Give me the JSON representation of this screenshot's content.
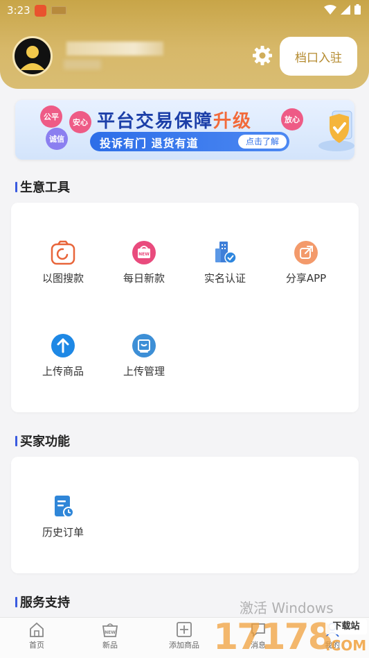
{
  "status_bar": {
    "time": "3:23"
  },
  "profile": {
    "enter_button": "档口入驻"
  },
  "banner": {
    "title_main": "平台交易保障",
    "title_highlight": "升级",
    "subtitle": "投诉有门 退货有道",
    "button": "点击了解",
    "tags": [
      "公平",
      "安心",
      "诚信",
      "放心"
    ]
  },
  "business_tools": {
    "title": "生意工具",
    "items": [
      {
        "label": "以图搜款",
        "icon": "camera-search-icon"
      },
      {
        "label": "每日新款",
        "icon": "new-bag-icon"
      },
      {
        "label": "实名认证",
        "icon": "verify-building-icon"
      },
      {
        "label": "分享APP",
        "icon": "share-icon"
      },
      {
        "label": "上传商品",
        "icon": "upload-arrow-icon"
      },
      {
        "label": "上传管理",
        "icon": "upload-manage-icon"
      }
    ]
  },
  "buyer_functions": {
    "title": "买家功能",
    "items": [
      {
        "label": "历史订单",
        "icon": "order-history-icon"
      }
    ]
  },
  "service_support": {
    "title": "服务支持"
  },
  "bottom_nav": {
    "items": [
      {
        "label": "首页",
        "icon": "home-icon"
      },
      {
        "label": "新品",
        "icon": "new-products-icon"
      },
      {
        "label": "添加商品",
        "icon": "add-product-icon"
      },
      {
        "label": "消息",
        "icon": "message-icon"
      },
      {
        "label": "我的",
        "icon": "profile-icon"
      }
    ]
  },
  "overlay": {
    "activate_windows": "激活 Windows",
    "site_logo": "17178",
    "site_tag": "下载站",
    "site_suffix": ".COM"
  },
  "colors": {
    "header_gold": "#c8a548",
    "accent_blue": "#3a5be0",
    "enter_text": "#b48a2e"
  }
}
